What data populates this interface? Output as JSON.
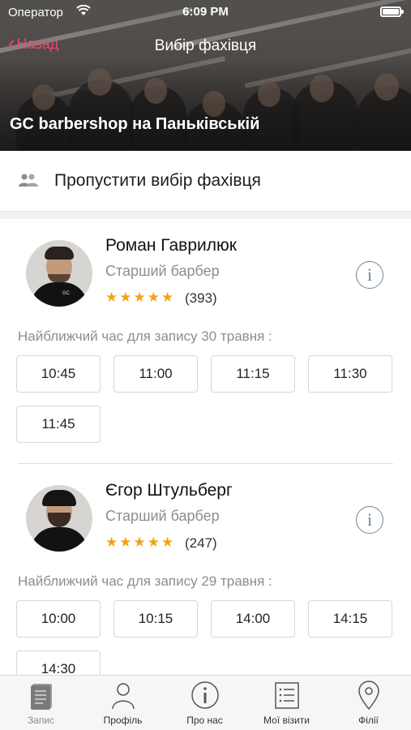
{
  "status_bar": {
    "carrier": "Оператор",
    "time": "6:09 PM"
  },
  "nav": {
    "back_label": "Назад",
    "title": "Вибір фахівця"
  },
  "branch_name": "GC barbershop на Паньківській",
  "skip": {
    "label": "Пропустити вибір фахівця",
    "icon": "people-icon"
  },
  "colors": {
    "accent": "#e94a6b",
    "stars": "#f4a40b",
    "info": "#6f8797"
  },
  "specialists": [
    {
      "name": "Роман Гаврилюк",
      "role": "Старший барбер",
      "stars": "★★★★★",
      "rating": 5,
      "reviews": "(393)",
      "nearest_label": "Найближчий час для запису 30 травня :",
      "slots": [
        "10:45",
        "11:00",
        "11:15",
        "11:30",
        "11:45"
      ]
    },
    {
      "name": "Єгор Штульберг",
      "role": "Старший барбер",
      "stars": "★★★★★",
      "rating": 5,
      "reviews": "(247)",
      "nearest_label": "Найближчий час для запису 29 травня :",
      "slots": [
        "10:00",
        "10:15",
        "14:00",
        "14:15",
        "14:30"
      ]
    }
  ],
  "tabbar": {
    "items": [
      {
        "label": "Запис",
        "icon": "notebook-icon",
        "active": true
      },
      {
        "label": "Профіль",
        "icon": "user-icon",
        "active": false
      },
      {
        "label": "Про нас",
        "icon": "info-icon",
        "active": false
      },
      {
        "label": "Мої візити",
        "icon": "list-icon",
        "active": false
      },
      {
        "label": "Філії",
        "icon": "location-pin-icon",
        "active": false
      }
    ]
  }
}
